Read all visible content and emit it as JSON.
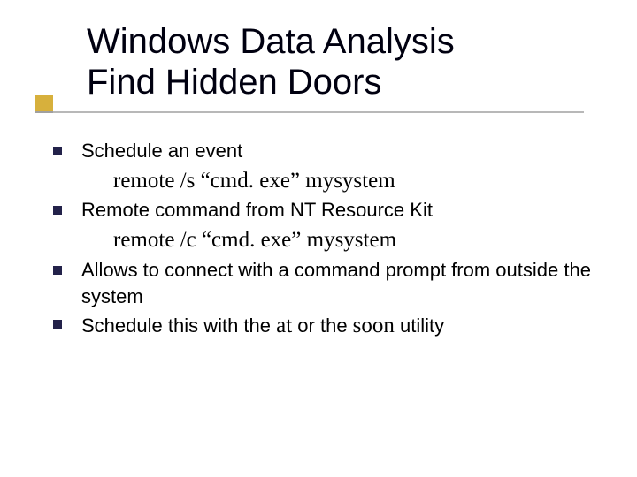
{
  "title": {
    "line1": "Windows Data Analysis",
    "line2": "Find Hidden Doors"
  },
  "bullets": {
    "b1": "Schedule an event",
    "code1": "remote /s “cmd. exe” mysystem",
    "b2": "Remote command from NT Resource Kit",
    "code2": "remote /c “cmd. exe” mysystem",
    "b3": "Allows to connect with a command prompt from outside the system",
    "b4_pre": "Schedule this with the ",
    "b4_at": "at",
    "b4_mid": " or the ",
    "b4_soon": "soon",
    "b4_post": " utility"
  }
}
